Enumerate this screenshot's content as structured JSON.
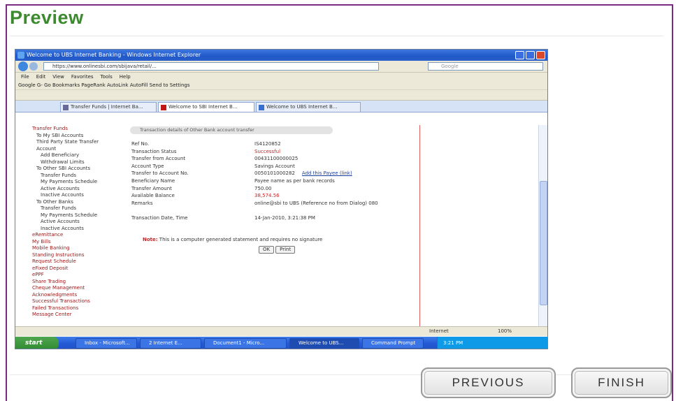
{
  "page": {
    "title": "Preview"
  },
  "screenshot": {
    "window_title": "Welcome to UBS Internet Banking - Windows Internet Explorer",
    "address": "https://www.onlinesbi.com/sbijava/retail/...",
    "search_placeholder": "Google",
    "menu": [
      "File",
      "Edit",
      "View",
      "Favorites",
      "Tools",
      "Help"
    ],
    "toolbar_text": "Google  G-  Go  Bookmarks  PageRank  AutoLink  AutoFill  Send to  Settings",
    "tabs": [
      "Transfer Funds | Internet Ba...",
      "Welcome to SBI Internet B...",
      "Welcome to UBS Internet B..."
    ],
    "sidebar": [
      {
        "text": "Transfer Funds",
        "level": 0
      },
      {
        "text": "To My SBI Accounts",
        "level": 1
      },
      {
        "text": "Third Party State Transfer",
        "level": 1
      },
      {
        "text": "Account",
        "level": 1
      },
      {
        "text": "Add Beneficiary",
        "level": 2
      },
      {
        "text": "Withdrawal Limits",
        "level": 2
      },
      {
        "text": "To Other SBI Accounts",
        "level": 1
      },
      {
        "text": "Transfer Funds",
        "level": 2
      },
      {
        "text": "My Payments Schedule",
        "level": 2
      },
      {
        "text": "Active Accounts",
        "level": 2
      },
      {
        "text": "Inactive Accounts",
        "level": 2
      },
      {
        "text": "To Other Banks",
        "level": 1
      },
      {
        "text": "Transfer Funds",
        "level": 2
      },
      {
        "text": "My Payments Schedule",
        "level": 2
      },
      {
        "text": "Active Accounts",
        "level": 2
      },
      {
        "text": "Inactive Accounts",
        "level": 2
      },
      {
        "text": "eRemittance",
        "level": 0
      },
      {
        "text": "My Bills",
        "level": 0
      },
      {
        "text": "Mobile Banking",
        "level": 0
      },
      {
        "text": "Standing Instructions",
        "level": 0
      },
      {
        "text": "Request Schedule",
        "level": 0
      },
      {
        "text": "eFixed Deposit",
        "level": 0
      },
      {
        "text": "ePPF",
        "level": 0
      },
      {
        "text": "Share Trading",
        "level": 0
      },
      {
        "text": "Cheque Management",
        "level": 0
      },
      {
        "text": "Acknowledgments",
        "level": 0
      },
      {
        "text": "Successful Transactions",
        "level": 0
      },
      {
        "text": "Failed Transactions",
        "level": 0
      },
      {
        "text": "Message Center",
        "level": 0
      }
    ],
    "panel_heading": "Transaction details of Other Bank account transfer",
    "details": [
      {
        "label": "Ref No.",
        "value": "IS4120852",
        "red": false
      },
      {
        "label": "Transaction Status",
        "value": "Successful",
        "red": true
      },
      {
        "label": "Transfer from Account",
        "value": "00431100000025",
        "red": false
      },
      {
        "label": "Account Type",
        "value": "Savings Account",
        "red": false
      },
      {
        "label": "Transfer to Account No.",
        "value": "0050101000282",
        "red": false,
        "link": "Add this Payee (link)"
      },
      {
        "label": "Beneficiary Name",
        "value": "Payee name as per bank records",
        "red": false
      },
      {
        "label": "Transfer Amount",
        "value": "750.00",
        "red": false
      },
      {
        "label": "Available Balance",
        "value": "38,574.56",
        "red": true
      },
      {
        "label": "Remarks",
        "value": "online@sbi to UBS (Reference no from Dialog) 080",
        "red": false
      },
      {
        "label": "",
        "value": "",
        "red": false
      },
      {
        "label": "Transaction Date, Time",
        "value": "14-Jan-2010, 3:21:38 PM",
        "red": false
      }
    ],
    "note": "This is a computer generated statement and requires no signature",
    "note_prefix": "Note:",
    "mini_buttons": [
      "OK",
      "Print"
    ],
    "status_zone": "Internet",
    "status_zoom": "100%",
    "taskbar_start": "start",
    "taskbar_tasks": [
      "Inbox - Microsoft...",
      "2 Internet E...",
      "Document1 - Micro...",
      "Welcome to UBS...",
      "Command Prompt"
    ],
    "taskbar_tray": "3:21 PM"
  },
  "buttons": {
    "previous": "PREVIOUS",
    "finish": "FINISH"
  },
  "colors": {
    "title": "#3c8a2e",
    "frame": "#7a2a80"
  }
}
